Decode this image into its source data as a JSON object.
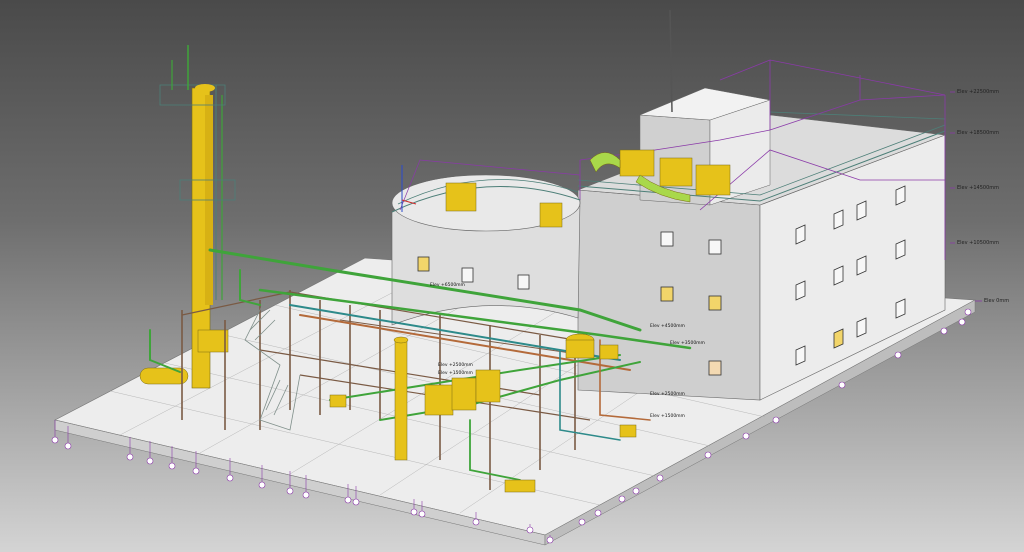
{
  "scene": {
    "title": "",
    "elevation_markers": [
      "Elev +22500mm",
      "Elev +18500mm",
      "Elev +14500mm",
      "Elev +10500mm",
      "Elev 0mm",
      "Elev +6500mm",
      "Elev +4500mm",
      "Elev +3500mm",
      "Elev +2500mm",
      "Elev +1500mm",
      "Elev +2500mm",
      "Elev +1500mm"
    ],
    "colors": {
      "background_top": "#4a4a4a",
      "background_bottom": "#d4d4d4",
      "building": "#e6e6e6",
      "vessel_yellow": "#e6c21a",
      "pipe_green": "#3fa43a",
      "steel_brown": "#7a5a44",
      "gridline_purple": "#8a3aa8",
      "slab": "#ececec"
    }
  }
}
